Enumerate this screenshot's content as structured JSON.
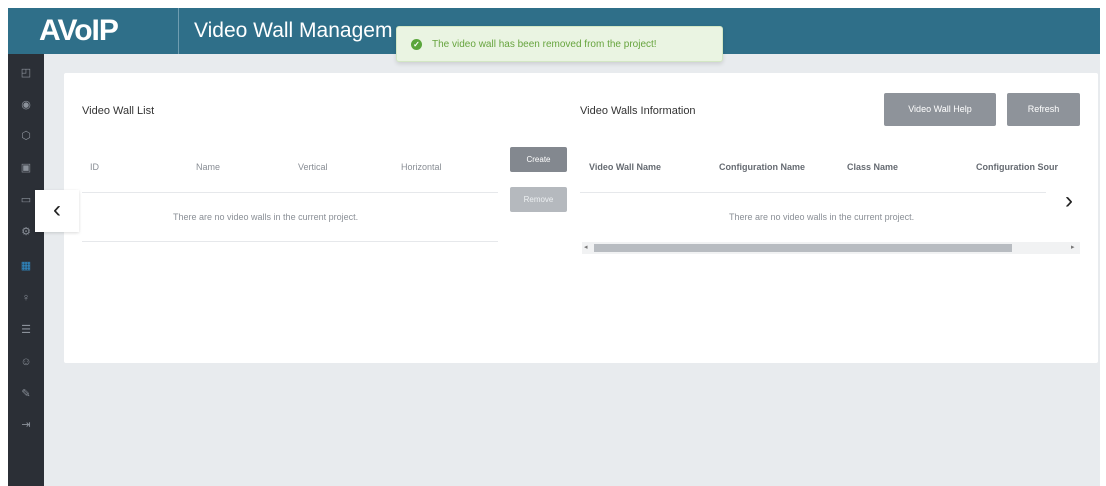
{
  "header": {
    "brand": "AVoIP",
    "title": "Video Wall Managem"
  },
  "toast": {
    "icon": "check-circle-icon",
    "message": "The video wall has been removed from the project!"
  },
  "sidebar": {
    "items": [
      {
        "icon": "dashboard-icon",
        "glyph": "◰"
      },
      {
        "icon": "radio-icon",
        "glyph": "◉"
      },
      {
        "icon": "layers-icon",
        "glyph": "⬡"
      },
      {
        "icon": "monitor-icon",
        "glyph": "▣"
      },
      {
        "icon": "display-icon",
        "glyph": "▭"
      },
      {
        "icon": "gear-icon",
        "glyph": "⚙"
      },
      {
        "icon": "video-wall-icon",
        "glyph": "▦"
      },
      {
        "icon": "user-icon",
        "glyph": "♀"
      },
      {
        "icon": "sliders-icon",
        "glyph": "☰"
      },
      {
        "icon": "person-icon",
        "glyph": "☺"
      },
      {
        "icon": "wrench-icon",
        "glyph": "✎"
      },
      {
        "icon": "logout-icon",
        "glyph": "⇥"
      }
    ],
    "active_index": 6
  },
  "left_panel": {
    "title": "Video Wall List",
    "columns": [
      "ID",
      "Name",
      "Vertical",
      "Horizontal"
    ],
    "empty_message": "There are no video walls in the current project."
  },
  "actions": {
    "create_label": "Create",
    "remove_label": "Remove"
  },
  "right_panel": {
    "title": "Video Walls Information",
    "help_label": "Video Wall Help",
    "refresh_label": "Refresh",
    "columns": [
      "Video Wall Name",
      "Configuration Name",
      "Class Name",
      "Configuration Sour"
    ],
    "empty_message": "There are no video walls in the current project."
  },
  "nav": {
    "prev": "‹",
    "next": "›",
    "scroll_left": "◂",
    "scroll_right": "▸"
  },
  "colors": {
    "header": "#2f6f89",
    "sidebar": "#2b2f36",
    "toast_bg": "#eaf4e2",
    "toast_text": "#67a43e",
    "button_gray": "#8e939a"
  }
}
